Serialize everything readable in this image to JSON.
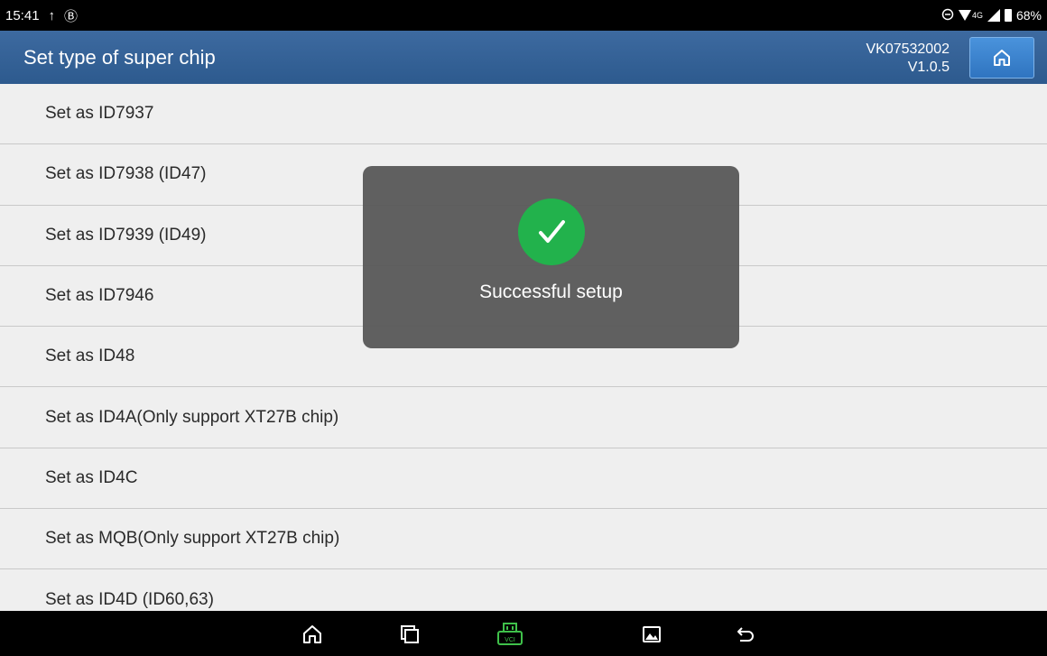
{
  "status_bar": {
    "time": "15:41",
    "upload_glyph": "↑",
    "bluetooth_glyph": "Ⓑ",
    "network": "4G",
    "battery": "68%",
    "icons": [
      "upload-icon",
      "bluetooth-icon",
      "dnd-icon",
      "wifi-icon",
      "signal-icon",
      "battery-icon"
    ]
  },
  "header": {
    "title": "Set type of super chip",
    "serial": "VK07532002",
    "version": "V1.0.5",
    "home_icon": "home-icon"
  },
  "menu": {
    "items": [
      "Set as ID7937",
      "Set as ID7938 (ID47)",
      "Set as ID7939 (ID49)",
      "Set as ID7946",
      "Set as ID48",
      "Set as ID4A(Only support XT27B chip)",
      "Set as ID4C",
      "Set as MQB(Only support XT27B chip)",
      "Set as ID4D (ID60,63)"
    ]
  },
  "toast": {
    "message": "Successful setup",
    "icon": "check-icon",
    "color": "#22b24c"
  },
  "nav_bar": {
    "buttons": [
      "home-icon",
      "recents-icon",
      "vci-icon",
      "screenshot-icon",
      "back-icon"
    ],
    "vci_label": "VCI",
    "vci_color": "#3fc14a"
  },
  "colors": {
    "header_bg": "#2d5a8e",
    "home_button_bg": "#2f74c0",
    "list_bg": "#efefef",
    "toast_bg": "#5a5a5a"
  }
}
